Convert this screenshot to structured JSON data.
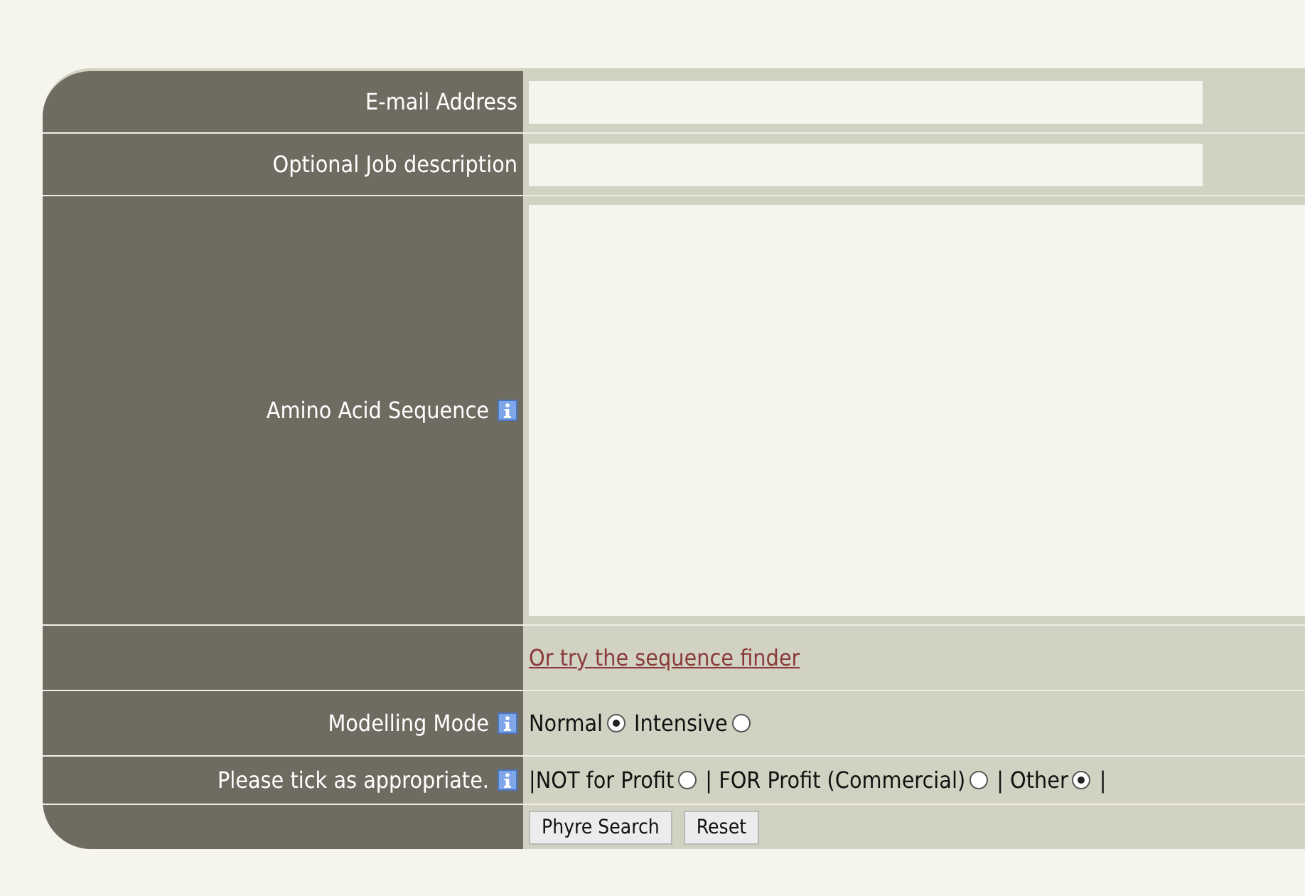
{
  "form": {
    "email": {
      "label": "E-mail Address"
    },
    "job": {
      "label": "Optional Job description"
    },
    "sequence": {
      "label": "Amino Acid Sequence",
      "info": true
    },
    "finder_link": "Or try the sequence finder",
    "modelling_mode": {
      "label": "Modelling Mode",
      "info": true,
      "options": [
        {
          "label": "Normal",
          "selected": true
        },
        {
          "label": "Intensive",
          "selected": false
        }
      ]
    },
    "usage": {
      "label": "Please tick as appropriate.",
      "info": true,
      "options": [
        {
          "label": "|NOT for Profit",
          "selected": false
        },
        {
          "label": "| FOR Profit (Commercial)",
          "selected": false
        },
        {
          "label": "| Other",
          "selected": true
        }
      ],
      "trailing": "|"
    },
    "buttons": [
      "Phyre Search",
      "Reset"
    ]
  }
}
